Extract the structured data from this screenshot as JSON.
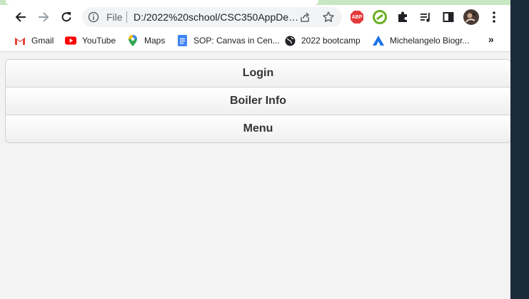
{
  "browser": {
    "omnibox": {
      "scheme_label": "File",
      "url": "D:/2022%20school/CSC350AppDe…"
    },
    "extensions": {
      "adblock_label": "ABP"
    },
    "bookmarks": [
      {
        "label": "Gmail",
        "icon": "gmail-icon"
      },
      {
        "label": "YouTube",
        "icon": "youtube-icon"
      },
      {
        "label": "Maps",
        "icon": "maps-pin-icon"
      },
      {
        "label": "SOP: Canvas in Cen...",
        "icon": "docs-icon"
      },
      {
        "label": "2022 bootcamp",
        "icon": "globe-icon"
      },
      {
        "label": "Michelangelo Biogr...",
        "icon": "triangle-logo-icon"
      }
    ],
    "bookmarks_more": "»"
  },
  "page": {
    "menu_items": [
      {
        "label": "Login"
      },
      {
        "label": "Boiler Info"
      },
      {
        "label": "Menu"
      }
    ]
  },
  "colors": {
    "tab_strip": "#c8e6c2",
    "page_background": "#f3f3f3",
    "desktop_background": "#1c2b3a",
    "menu_text": "#333333"
  }
}
